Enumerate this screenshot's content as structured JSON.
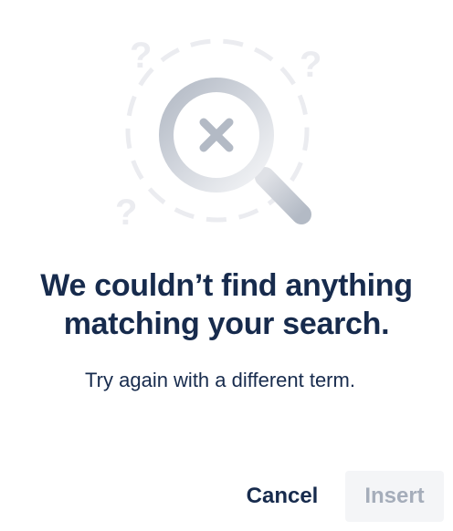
{
  "empty_state": {
    "illustration_icon": "search-no-results-icon",
    "title_line1": "We couldn’t find anything",
    "title_line2": "matching your search.",
    "subtitle": "Try again with a different term."
  },
  "actions": {
    "cancel_label": "Cancel",
    "insert_label": "Insert"
  },
  "colors": {
    "text": "#172b4d",
    "disabled_text": "#a5adba",
    "disabled_bg": "#f4f5f7",
    "illustration_gray": "#c1c7d0"
  }
}
